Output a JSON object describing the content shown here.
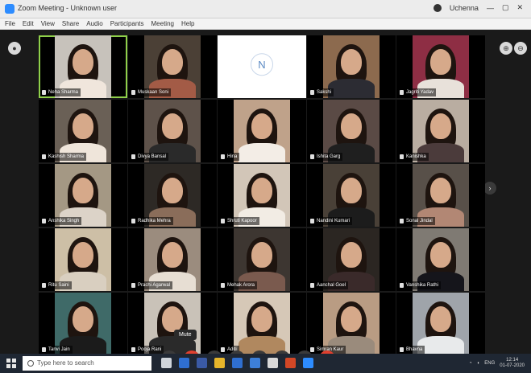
{
  "window": {
    "title": "Zoom Meeting - Unknown user",
    "account": "Uchenna"
  },
  "menu": [
    "File",
    "Edit",
    "View",
    "Share",
    "Audio",
    "Participants",
    "Meeting",
    "Help"
  ],
  "participants": [
    {
      "name": "Neha Sharma",
      "photo": "#c7c2bb",
      "body": "#f0e6dc"
    },
    {
      "name": "Muskaan Soni",
      "photo": "#4b4036",
      "body": "#a35b46"
    },
    {
      "name": "N",
      "avatar": true
    },
    {
      "name": "Sakshi",
      "photo": "#8c6a4e",
      "body": "#2c2c33"
    },
    {
      "name": "Jagriti Yadav",
      "photo": "#8e2e44",
      "body": "#e8e1da"
    },
    {
      "name": "Kashish Sharma",
      "photo": "#6a6056",
      "body": "#efe5da"
    },
    {
      "name": "Divya Bansal",
      "photo": "#5e524a",
      "body": "#2a2a2a"
    },
    {
      "name": "Hina",
      "photo": "#bfa28a",
      "body": "#f3ede6"
    },
    {
      "name": "Ishita Garg",
      "photo": "#5a4a45",
      "body": "#1f1f1f"
    },
    {
      "name": "Kanishka",
      "photo": "#b9ada1",
      "body": "#4b3b3b"
    },
    {
      "name": "Anshika Singh",
      "photo": "#a49884",
      "body": "#dcd3c8"
    },
    {
      "name": "Radhika Mehra",
      "photo": "#2d2925",
      "body": "#8a6d5a"
    },
    {
      "name": "Shruti Kapoor",
      "photo": "#d2c6b8",
      "body": "#f2ece4"
    },
    {
      "name": "Nandini Kumari",
      "photo": "#494037",
      "body": "#1c1c1c"
    },
    {
      "name": "Sonal Jindal",
      "photo": "#585049",
      "body": "#b28774"
    },
    {
      "name": "Ritu Saini",
      "photo": "#cdbfa6",
      "body": "#d9cfc0"
    },
    {
      "name": "Prachi Agarwal",
      "photo": "#9b8c7e",
      "body": "#e7ded3"
    },
    {
      "name": "Mehak Arora",
      "photo": "#3d3631",
      "body": "#7a5a4e"
    },
    {
      "name": "Aanchal Goel",
      "photo": "#2b2622",
      "body": "#3a2a2a"
    },
    {
      "name": "Vanshika Rathi",
      "photo": "#7f7a73",
      "body": "#15151b"
    },
    {
      "name": "Tanvi Jain",
      "photo": "#3f6a68",
      "body": "#1b1b1b"
    },
    {
      "name": "Pooja Rani",
      "photo": "#c9c2b8",
      "body": "#2a2a2a"
    },
    {
      "name": "Aditi",
      "photo": "#d6c8b7",
      "body": "#b0885f"
    },
    {
      "name": "Simran Kaur",
      "photo": "#b99c83",
      "body": "#9a8b7c"
    },
    {
      "name": "Bhavna",
      "photo": "#9fa4aa",
      "body": "#e8eaeb"
    }
  ],
  "tooltip": "Mute",
  "controls": [
    {
      "name": "mute",
      "symbol": "🎤",
      "red": false
    },
    {
      "name": "video",
      "symbol": "●",
      "red": true
    },
    {
      "name": "security",
      "symbol": "⛨",
      "red": false
    },
    {
      "name": "participants",
      "symbol": "⚇",
      "red": false
    },
    {
      "name": "chat",
      "symbol": "✉",
      "red": false
    },
    {
      "name": "share-screen",
      "symbol": "⇪",
      "red": false
    },
    {
      "name": "record",
      "symbol": "⏺",
      "red": false
    },
    {
      "name": "end",
      "symbol": "✕",
      "red": true
    }
  ],
  "taskbar": {
    "search_placeholder": "Type here to search",
    "tray_lang": "ENG",
    "time": "12:14",
    "date": "01-07-2020"
  }
}
